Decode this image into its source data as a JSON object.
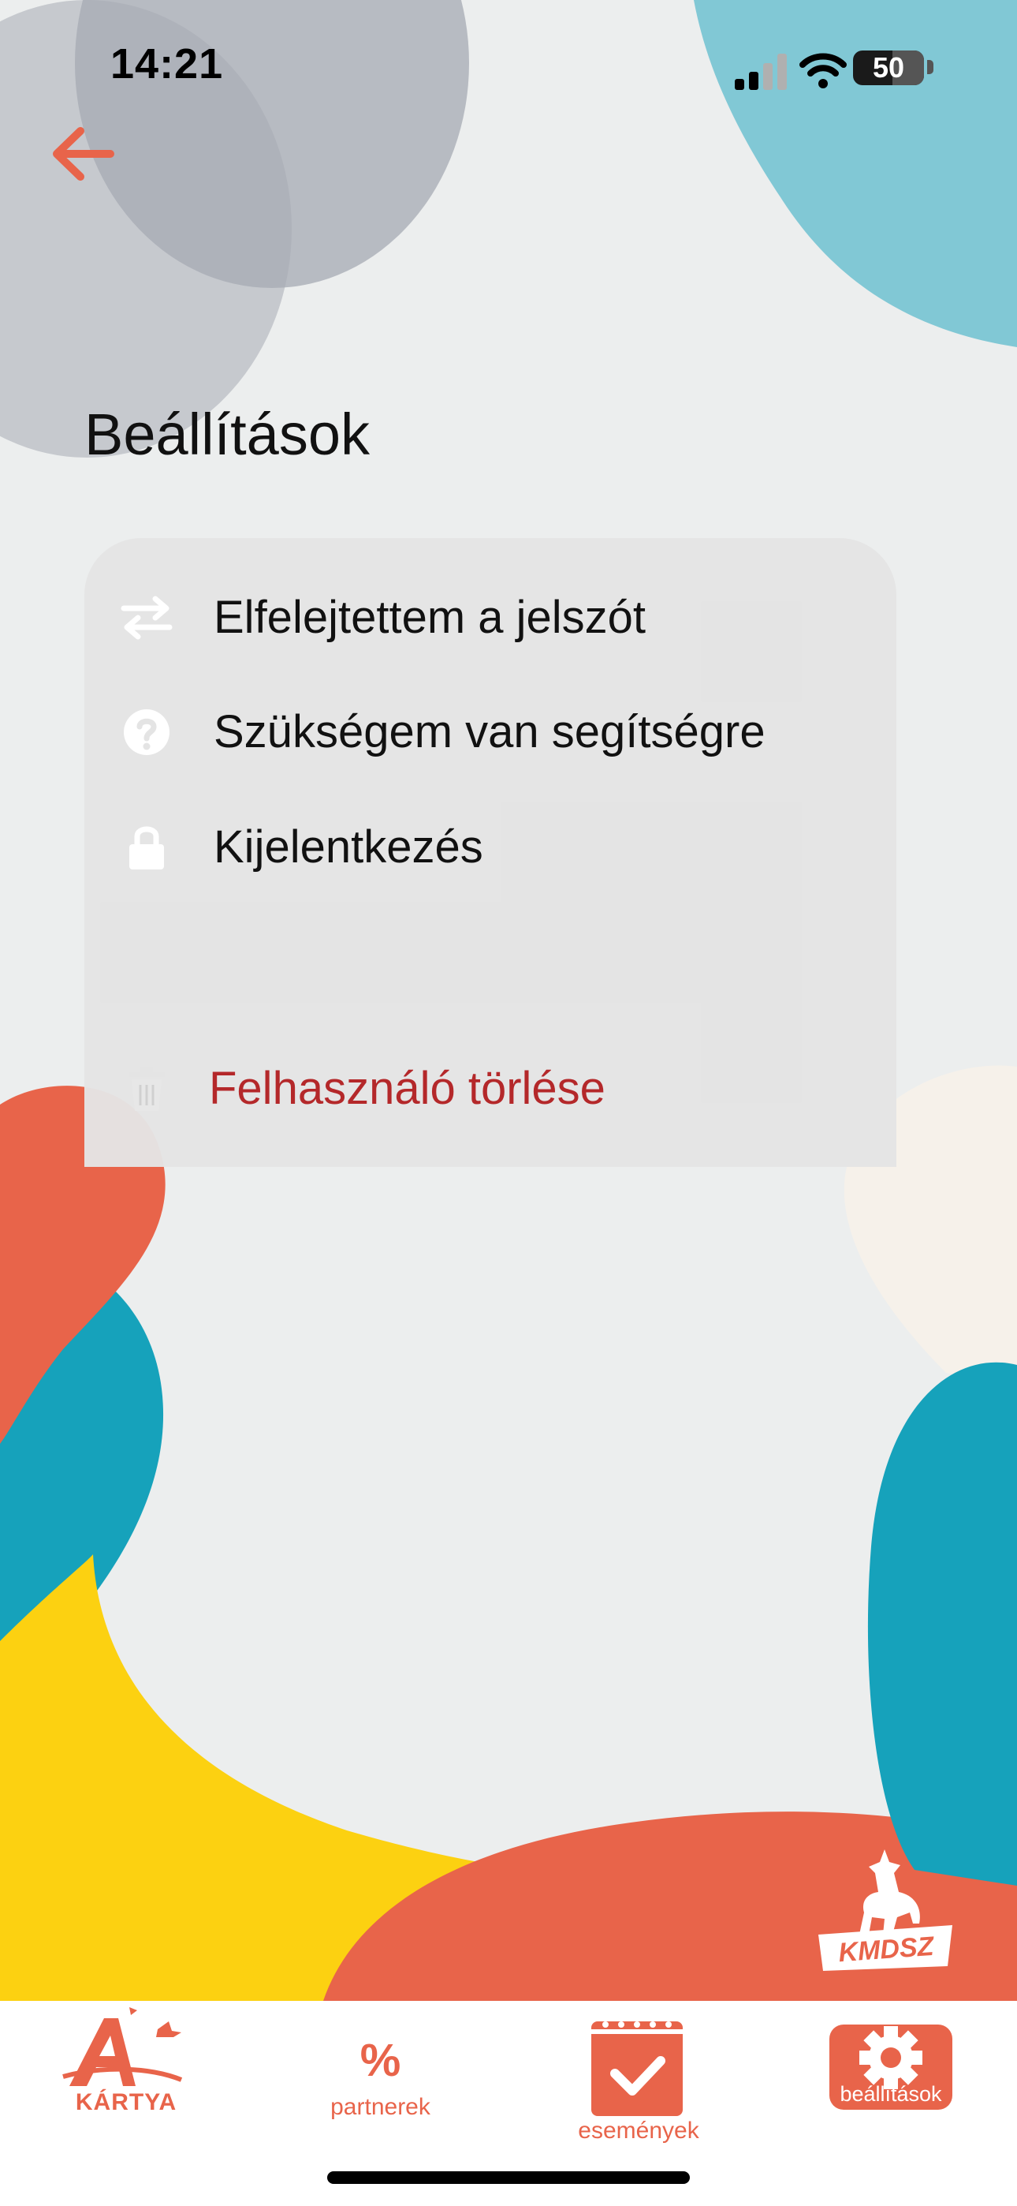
{
  "status_bar": {
    "time": "14:21",
    "battery": "50"
  },
  "header": {
    "title": "Beállítások"
  },
  "settings": {
    "items": [
      {
        "label": "Elfelejtettem a jelszót",
        "icon": "swap-arrows-icon"
      },
      {
        "label": "Szükségem van segítségre",
        "icon": "help-circle-icon"
      },
      {
        "label": "Kijelentkezés",
        "icon": "lock-icon"
      }
    ],
    "delete": {
      "label": "Felhasználó törlése",
      "icon": "trash-icon"
    }
  },
  "logo": {
    "text": "KMDSZ"
  },
  "nav": {
    "karta": "KÁRTYA",
    "partnerek_symbol": "%",
    "partnerek": "partnerek",
    "esemenyek": "események",
    "beallitasok": "beállítások"
  },
  "colors": {
    "accent": "#e8644a",
    "danger": "#b4282a",
    "background": "#eceeee",
    "card": "#e4e4e4",
    "teal": "#16a2bb",
    "yellow": "#fcd111"
  }
}
